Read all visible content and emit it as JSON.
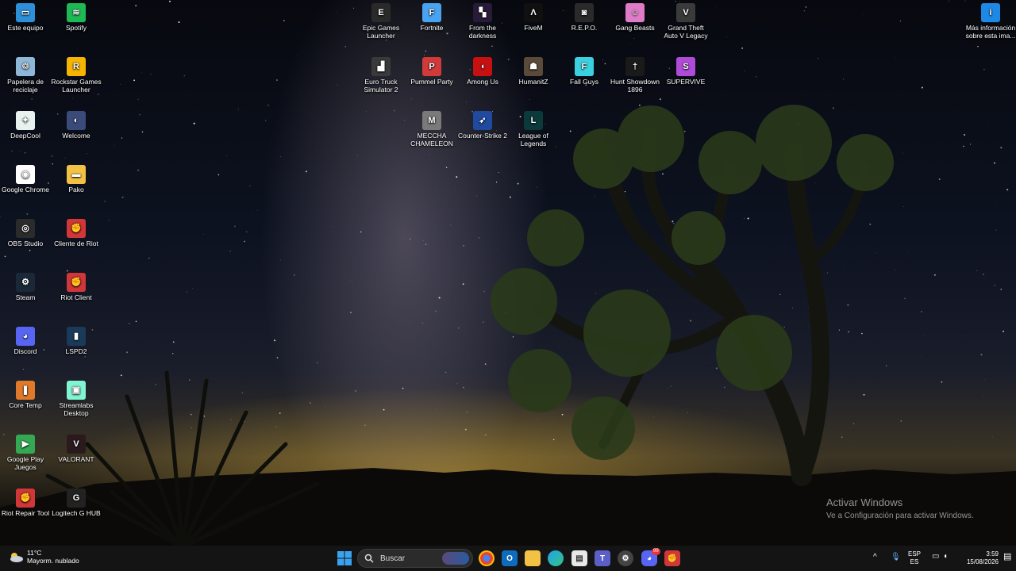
{
  "desktop": {
    "icons": [
      {
        "label": "Este equipo",
        "color": "#2d8fd8",
        "glyph": "▭"
      },
      {
        "label": "Spotify",
        "color": "#1db954",
        "glyph": "≋"
      },
      {
        "label": "Papelera de reciclaje",
        "color": "#8fb7d8",
        "glyph": "♲"
      },
      {
        "label": "Rockstar Games Launcher",
        "color": "#f5b400",
        "glyph": "R"
      },
      {
        "label": "DeepCool",
        "color": "#e8f3f0",
        "glyph": "✦"
      },
      {
        "label": "Welcome",
        "color": "#3a4b7a",
        "glyph": "◐"
      },
      {
        "label": "Google Chrome",
        "color": "#ffffff",
        "glyph": "◉"
      },
      {
        "label": "Pako",
        "color": "#f3c244",
        "glyph": "▬"
      },
      {
        "label": "OBS Studio",
        "color": "#2b2b2b",
        "glyph": "◎"
      },
      {
        "label": "Cliente de Riot",
        "color": "#d13639",
        "glyph": "✊"
      },
      {
        "label": "Steam",
        "color": "#1b2838",
        "glyph": "⚙"
      },
      {
        "label": "Riot Client",
        "color": "#d13639",
        "glyph": "✊"
      },
      {
        "label": "Discord",
        "color": "#5865f2",
        "glyph": "◕"
      },
      {
        "label": "LSPD2",
        "color": "#1a3a5a",
        "glyph": "▮"
      },
      {
        "label": "Core Temp",
        "color": "#e07a2a",
        "glyph": "❚"
      },
      {
        "label": "Streamlabs Desktop",
        "color": "#80f5d2",
        "glyph": "▣"
      },
      {
        "label": "Google Play Juegos",
        "color": "#34a853",
        "glyph": "▶"
      },
      {
        "label": "VALORANT",
        "color": "#2a1a1e",
        "glyph": "V"
      },
      {
        "label": "Riot Repair Tool",
        "color": "#d13639",
        "glyph": "✊"
      },
      {
        "label": "Logitech G HUB",
        "color": "#222222",
        "glyph": "G"
      },
      {
        "label": "Epic Games Launcher",
        "color": "#2a2a2a",
        "glyph": "E"
      },
      {
        "label": "Fortnite",
        "color": "#4aa3f0",
        "glyph": "F"
      },
      {
        "label": "From the darkness",
        "color": "#2a1a3a",
        "glyph": "▚"
      },
      {
        "label": "FiveM",
        "color": "#101010",
        "glyph": "Λ"
      },
      {
        "label": "R.E.P.O.",
        "color": "#2a2a2a",
        "glyph": "◙"
      },
      {
        "label": "Gang Beasts",
        "color": "#e07bc8",
        "glyph": "☺"
      },
      {
        "label": "Grand Theft Auto V Legacy",
        "color": "#3a3a3a",
        "glyph": "V"
      },
      {
        "label": "Euro Truck Simulator 2",
        "color": "#3a3a3a",
        "glyph": "▟"
      },
      {
        "label": "Pummel Party",
        "color": "#d13a3a",
        "glyph": "P"
      },
      {
        "label": "Among Us",
        "color": "#c51111",
        "glyph": "◖"
      },
      {
        "label": "HumanitZ",
        "color": "#5a4a3a",
        "glyph": "☗"
      },
      {
        "label": "Fall Guys",
        "color": "#3ad0e0",
        "glyph": "F"
      },
      {
        "label": "Hunt Showdown 1896",
        "color": "#1a1a1a",
        "glyph": "†"
      },
      {
        "label": "SUPERVIVE",
        "color": "#b04ad8",
        "glyph": "S"
      },
      {
        "label": "MECCHA CHAMELEON",
        "color": "#7a7a7a",
        "glyph": "M"
      },
      {
        "label": "Counter-Strike 2",
        "color": "#1f4aa0",
        "glyph": "➶"
      },
      {
        "label": "League of Legends",
        "color": "#0a3a3a",
        "glyph": "L"
      },
      {
        "label": "Más información sobre esta ima...",
        "color": "#1e88e5",
        "glyph": "i"
      }
    ]
  },
  "activation": {
    "title": "Activar Windows",
    "subtitle": "Ve a Configuración para activar Windows."
  },
  "taskbar": {
    "weather_temp": "11°C",
    "weather_desc": "Mayorm. nublado",
    "search_placeholder": "Buscar",
    "discord_badge": "99",
    "lang_top": "ESP",
    "lang_bottom": "ES",
    "time": "3:59",
    "date": "15/08/2026"
  }
}
